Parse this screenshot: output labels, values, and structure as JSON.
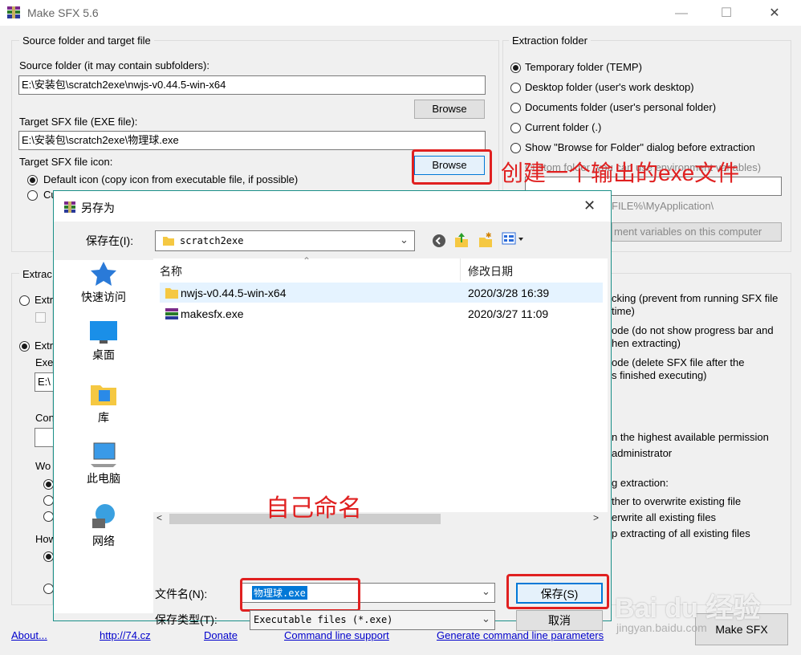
{
  "window": {
    "title": "Make SFX 5.6",
    "controls": [
      "—",
      "☐",
      "✕"
    ]
  },
  "source_group": {
    "label": "Source folder and target file",
    "source_label": "Source folder (it may contain subfolders):",
    "source_value": "E:\\安装包\\scratch2exe\\nwjs-v0.44.5-win-x64",
    "browse1": "Browse",
    "target_label": "Target SFX file (EXE file):",
    "target_value": "E:\\安装包\\scratch2exe\\物理球.exe",
    "browse2": "Browse",
    "icon_label": "Target SFX file icon:",
    "icon_default": "Default icon (copy icon from executable file, if possible)",
    "icon_custom_partial": "Cu"
  },
  "extraction_group": {
    "label": "Extraction folder",
    "options": [
      "Temporary folder (TEMP)",
      "Desktop folder (user's work desktop)",
      "Documents folder (user's personal folder)",
      "Current folder (.)",
      "Show \"Browse for Folder\" dialog before extraction",
      "Custom folder (you can use environment variables)"
    ],
    "custom_value": "FILE%\\MyApplication\\",
    "env_button": "ment variables on this computer"
  },
  "left_partial": {
    "group_label": "Extrac",
    "opt1": "Extr",
    "opt2": "Extr",
    "exe": "Exe",
    "field": "E:\\",
    "con": "Con",
    "wo": "Wo",
    "how": "How"
  },
  "right_partial": {
    "lines": [
      "cking (prevent from running SFX file",
      "time)",
      "ode (do not show progress bar and",
      "hen extracting)",
      "ode (delete SFX file after the",
      "s finished executing)",
      "n the highest available permission",
      "administrator",
      "g extraction:",
      "ther to overwrite existing file",
      "erwrite all existing files",
      "p extracting of all existing files"
    ]
  },
  "footer": {
    "about": "About...",
    "site": "http://74.cz",
    "donate": "Donate",
    "cmd": "Command line support",
    "gen": "Generate command line parameters",
    "make": "Make SFX"
  },
  "dialog": {
    "title": "另存为",
    "save_in_label": "保存在(I):",
    "save_in_value": "scratch2exe",
    "places": [
      "快速访问",
      "桌面",
      "库",
      "此电脑",
      "网络"
    ],
    "columns": {
      "name": "名称",
      "date": "修改日期"
    },
    "files": [
      {
        "name": "nwjs-v0.44.5-win-x64",
        "date": "2020/3/28 16:39",
        "icon": "folder-icon"
      },
      {
        "name": "makesfx.exe",
        "date": "2020/3/27 11:09",
        "icon": "winrar-icon"
      }
    ],
    "filename_label": "文件名(N):",
    "filename_value": "物理球.exe",
    "filetype_label": "保存类型(T):",
    "filetype_value": "Executable files (*.exe)",
    "save_button": "保存(S)",
    "cancel_button": "取消"
  },
  "annotations": {
    "create_exe": "创建一个输出的exe文件",
    "self_name": "自己命名"
  },
  "watermark": {
    "brand": "Bai du 经验",
    "url": "jingyan.baidu.com"
  },
  "colors": {
    "accent_red": "#e02020",
    "dialog_border": "#1a8f88",
    "selection_blue": "#0078d7"
  }
}
